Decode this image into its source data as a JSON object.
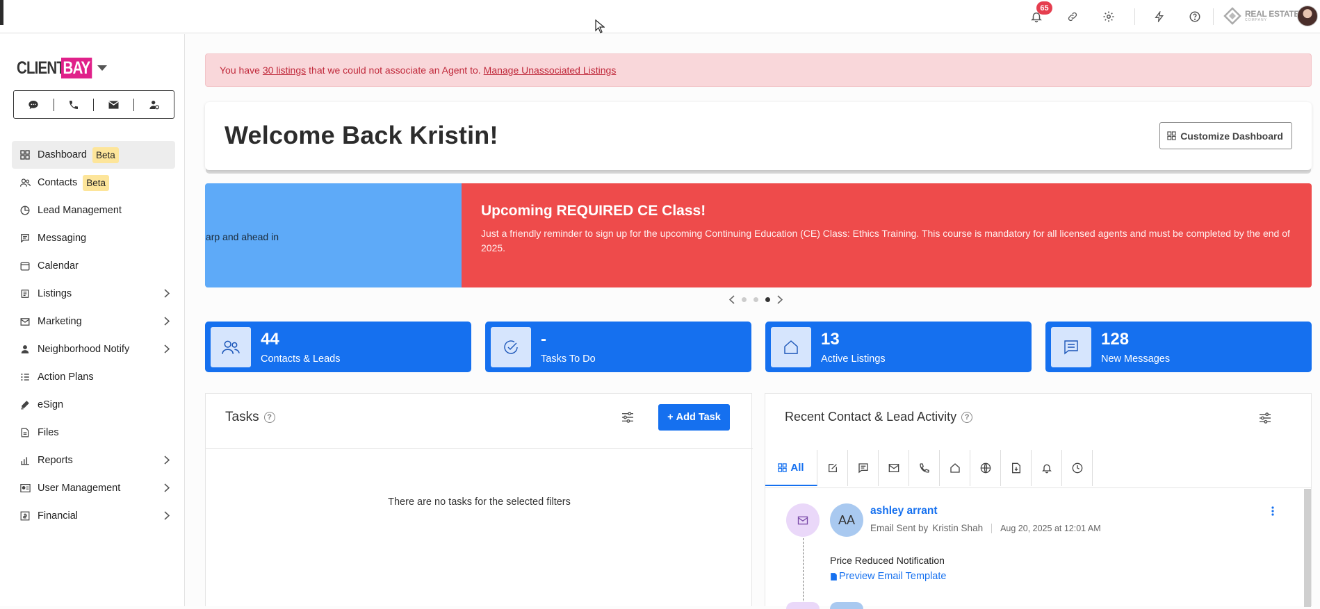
{
  "topbar": {
    "notifications_count": "65",
    "icons": [
      "bell-icon",
      "link-icon",
      "gear-icon",
      "lightning-icon",
      "help-icon"
    ],
    "brand_line1": "REAL ESTATE",
    "brand_line2": "COMPANY"
  },
  "sidebar": {
    "logo_client": "CLIENT",
    "logo_bay": "BAY",
    "comm_icons": [
      "chat-icon",
      "phone-icon",
      "mail-icon",
      "contact-icon"
    ],
    "items": [
      {
        "label": "Dashboard",
        "badge": "Beta",
        "active": true
      },
      {
        "label": "Contacts",
        "badge": "Beta"
      },
      {
        "label": "Lead Management"
      },
      {
        "label": "Messaging"
      },
      {
        "label": "Calendar"
      },
      {
        "label": "Listings",
        "chevron": true
      },
      {
        "label": "Marketing",
        "chevron": true
      },
      {
        "label": "Neighborhood Notify",
        "chevron": true
      },
      {
        "label": "Action Plans"
      },
      {
        "label": "eSign"
      },
      {
        "label": "Files"
      },
      {
        "label": "Reports",
        "chevron": true
      },
      {
        "label": "User Management",
        "chevron": true
      },
      {
        "label": "Financial",
        "chevron": true
      }
    ]
  },
  "alert": {
    "prefix": "You have",
    "link1": "30 listings",
    "middle": "that we could not associate an Agent to.",
    "link2": "Manage Unassociated Listings"
  },
  "welcome": {
    "title": "Welcome Back Kristin!",
    "customize_label": "Customize Dashboard"
  },
  "carousel": {
    "prev_slide_text": "arp and ahead in",
    "current_title": "Upcoming REQUIRED CE Class!",
    "current_body": "Just a friendly reminder to sign up for the upcoming Continuing Education (CE) Class: Ethics Training. This course is mandatory for all licensed agents and must be completed by the end of 2025.",
    "dot_count": 3,
    "active_dot": 3
  },
  "stats": [
    {
      "value": "44",
      "label": "Contacts & Leads",
      "icon": "people-icon"
    },
    {
      "value": "-",
      "label": "Tasks To Do",
      "icon": "check-circle-icon"
    },
    {
      "value": "13",
      "label": "Active Listings",
      "icon": "house-icon"
    },
    {
      "value": "128",
      "label": "New Messages",
      "icon": "message-icon"
    }
  ],
  "tasks": {
    "title": "Tasks",
    "add_label": "Add Task",
    "empty_text": "There are no tasks for the selected filters"
  },
  "activity": {
    "title": "Recent Contact & Lead Activity",
    "tab_all_label": "All",
    "tab_icons": [
      "edit-icon",
      "sms-icon",
      "mail-icon",
      "phone-icon",
      "house-icon",
      "globe-icon",
      "document-icon",
      "bell-icon",
      "clock-icon"
    ],
    "entry": {
      "initials": "AA",
      "name": "ashley arrant",
      "action": "Email Sent by",
      "by": "Kristin Shah",
      "timestamp": "Aug 20, 2025 at 12:01 AM",
      "subject": "Price Reduced Notification",
      "link": "Preview Email Template"
    }
  },
  "colors": {
    "primary": "#1570ef",
    "alert_bg": "#f9d7da",
    "slide_red": "#ee4b4b",
    "slide_blue": "#5eaaf8",
    "beta_badge": "#fde59a",
    "brand_pink": "#e0218a"
  }
}
